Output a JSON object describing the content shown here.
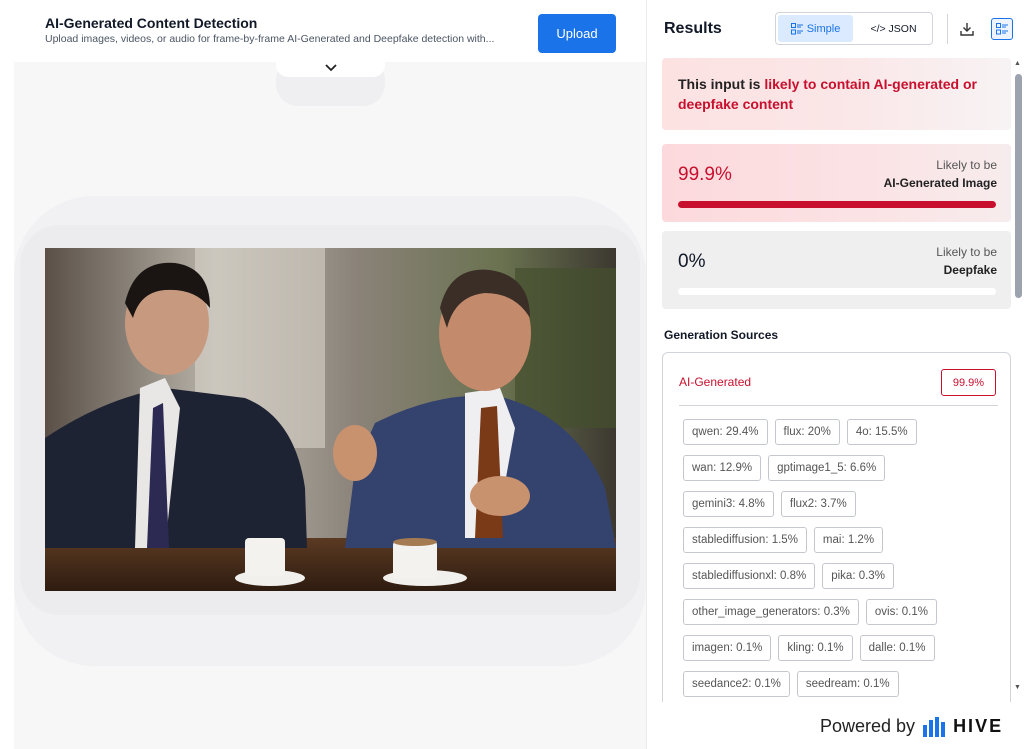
{
  "header": {
    "title": "AI-Generated Content Detection",
    "subtitle": "Upload images, videos, or audio for frame-by-frame AI-Generated and Deepfake detection with...",
    "upload_label": "Upload"
  },
  "results": {
    "title": "Results",
    "view_simple": "Simple",
    "view_json": "</> JSON",
    "banner_prefix": "This input is ",
    "banner_highlight": "likely to contain AI-generated or deepfake content",
    "ai_card": {
      "percent": "99.9%",
      "likely": "Likely to be",
      "kind": "AI-Generated Image",
      "fraction": 0.999
    },
    "deepfake_card": {
      "percent": "0%",
      "likely": "Likely to be",
      "kind": "Deepfake",
      "fraction": 0.0
    },
    "generation_sources_title": "Generation Sources",
    "generation_label": "AI-Generated",
    "generation_badge": "99.9%",
    "sources": [
      [
        "qwen: 29.4%",
        "flux: 20%",
        "4o: 15.5%"
      ],
      [
        "wan: 12.9%",
        "gptimage1_5: 6.6%"
      ],
      [
        "gemini3: 4.8%",
        "flux2: 3.7%"
      ],
      [
        "stablediffusion: 1.5%",
        "mai: 1.2%"
      ],
      [
        "stablediffusionxl: 0.8%",
        "pika: 0.3%"
      ],
      [
        "other_image_generators: 0.3%",
        "ovis: 0.1%"
      ],
      [
        "imagen: 0.1%",
        "kling: 0.1%",
        "dalle: 0.1%"
      ],
      [
        "seedance2: 0.1%",
        "seedream: 0.1%"
      ]
    ]
  },
  "footer": {
    "powered_by": "Powered by",
    "brand": "HIVE"
  },
  "colors": {
    "accent": "#1a73e8",
    "danger": "#c8102e"
  },
  "icons": [
    "chevron-down-icon",
    "list-view-icon",
    "code-icon",
    "download-icon",
    "hive-logo-icon"
  ]
}
